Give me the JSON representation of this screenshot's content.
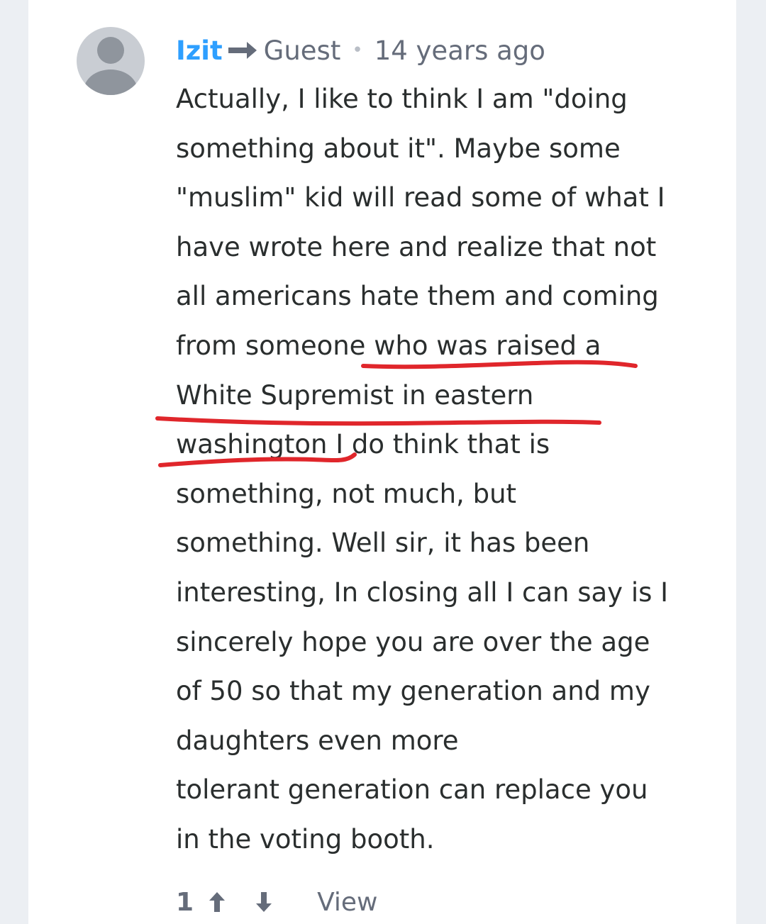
{
  "comment": {
    "author": "Izit",
    "reply_to": "Guest",
    "separator": "•",
    "timestamp": "14 years ago",
    "lines": [
      "Actually, I like to think I am \"doing",
      "something about it\". Maybe some",
      "\"muslim\" kid will read some of what I",
      "have wrote here and realize that not",
      "all americans hate them and coming",
      "from someone who was raised a",
      "White Supremist in eastern",
      "washington I do think that is",
      "something, not much, but",
      "something. Well sir, it has been",
      "interesting, In closing all I can say is I",
      "sincerely hope you are over the age",
      "of 50 so that my generation and my",
      "daughters even more",
      "tolerant generation can replace you",
      "in the voting booth."
    ]
  },
  "actions": {
    "vote_count": "1",
    "upvote_icon": "arrow-up-icon",
    "downvote_icon": "arrow-down-icon",
    "view_label": "View"
  },
  "colors": {
    "author": "#2e9fff",
    "meta_text": "#656c7a",
    "body_text": "#2a2e2e",
    "underline": "#e0262b",
    "page_background": "#eceff3",
    "card_background": "#ffffff"
  },
  "icons": {
    "reply_arrow": "reply-arrow-icon",
    "avatar": "default-avatar-icon"
  }
}
